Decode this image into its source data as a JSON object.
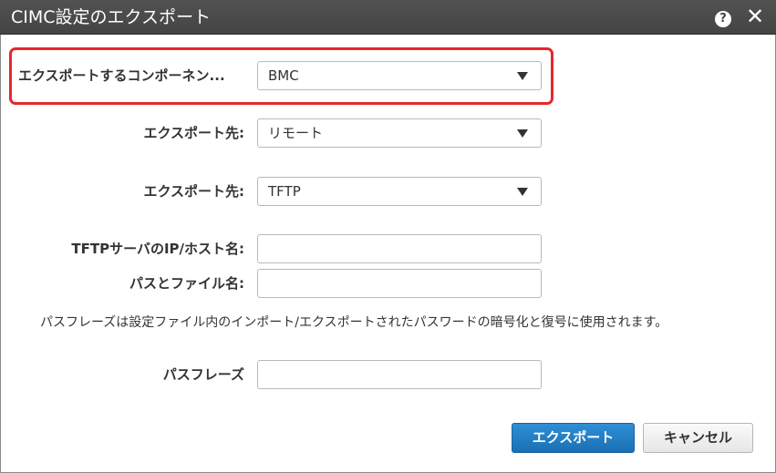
{
  "dialog": {
    "title": "CIMC設定のエクスポート",
    "help_icon": "question-circle-icon",
    "help_glyph": "?",
    "close_icon": "close-icon",
    "close_glyph": "✕"
  },
  "form": {
    "component": {
      "label": "エクスポートするコンポーネン...",
      "value": "BMC"
    },
    "destination": {
      "label": "エクスポート先:",
      "value": "リモート"
    },
    "protocol": {
      "label": "エクスポート先:",
      "value": "TFTP"
    },
    "server": {
      "label": "TFTPサーバのIP/ホスト名:",
      "value": ""
    },
    "path": {
      "label": "パスとファイル名:",
      "value": ""
    },
    "note": "パスフレーズは設定ファイル内のインポート/エクスポートされたパスワードの暗号化と復号に使用されます。",
    "passphrase": {
      "label": "パスフレーズ",
      "value": ""
    }
  },
  "buttons": {
    "export_label": "エクスポート",
    "cancel_label": "キャンセル"
  },
  "colors": {
    "highlight_border": "#e8262b",
    "primary_button": "#1a6fb4",
    "titlebar": "#4a4a4a"
  }
}
